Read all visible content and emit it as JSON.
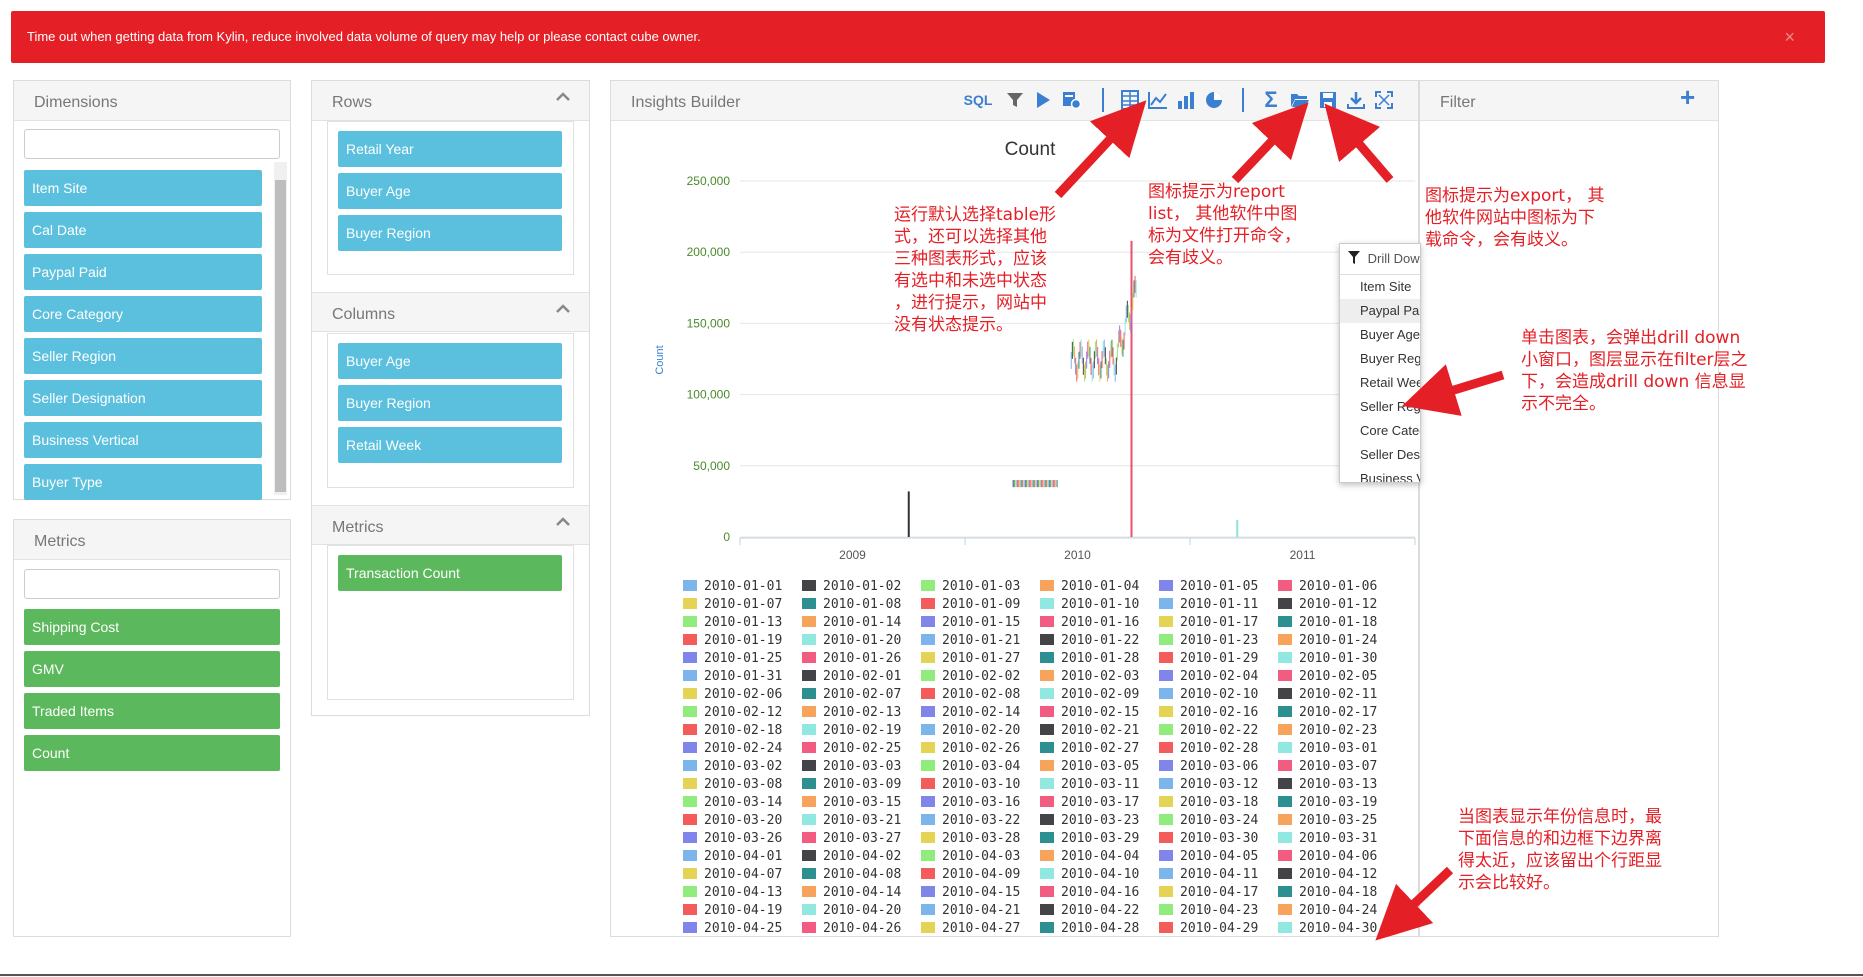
{
  "alert": {
    "message": "Time out when getting data from Kylin, reduce involved data volume of query may help or please contact cube owner.",
    "close": "×"
  },
  "dimensions": {
    "title": "Dimensions",
    "search_value": "",
    "items": [
      "Item Site",
      "Cal Date",
      "Paypal Paid",
      "Core Category",
      "Seller Region",
      "Seller Designation",
      "Business Vertical",
      "Buyer Type"
    ]
  },
  "metrics_left": {
    "title": "Metrics",
    "search_value": "",
    "items": [
      "Shipping Cost",
      "GMV",
      "Traded Items",
      "Count"
    ]
  },
  "rows": {
    "title": "Rows",
    "items": [
      "Retail Year",
      "Buyer Age",
      "Buyer Region"
    ]
  },
  "columns": {
    "title": "Columns",
    "items": [
      "Buyer Age",
      "Buyer Region",
      "Retail Week"
    ]
  },
  "metrics_mid": {
    "title": "Metrics",
    "items": [
      "Transaction Count"
    ]
  },
  "insights": {
    "title": "Insights Builder",
    "sql_label": "SQL"
  },
  "toolbar_icons": [
    "filter-icon",
    "run-icon",
    "settings-run-icon",
    "table-icon",
    "line-chart-icon",
    "bar-chart-icon",
    "pie-chart-icon",
    "sum-icon",
    "open-folder-icon",
    "save-icon",
    "export-download-icon",
    "fullscreen-icon"
  ],
  "filter": {
    "title": "Filter",
    "add": "+"
  },
  "drill": {
    "title": "Drill Down",
    "items": [
      "Item Site",
      "Paypal Paid",
      "Buyer Age",
      "Buyer Region",
      "Retail Week",
      "Seller Region",
      "Core Category",
      "Seller Designation",
      "Business Vertical"
    ]
  },
  "chart_data": {
    "type": "bar",
    "title": "Count",
    "ylabel": "Count",
    "ylim": [
      0,
      250000
    ],
    "yticks": [
      0,
      50000,
      100000,
      150000,
      200000,
      250000
    ],
    "ytick_labels": [
      "0",
      "50,000",
      "100,000",
      "150,000",
      "200,000",
      "250,000"
    ],
    "categories": [
      "2009",
      "2010",
      "2011"
    ],
    "marks": [
      {
        "x": 2009.25,
        "value": 32000,
        "color": "#333333"
      },
      {
        "x": 2010.24,
        "value": 208000,
        "color": "#e8506b"
      },
      {
        "x": 2010.71,
        "value": 12000,
        "color": "#8ee0e0"
      }
    ],
    "colors": [
      "#7cb5ec",
      "#434348",
      "#90ed7d",
      "#f7a35c",
      "#8085e9",
      "#f15c80",
      "#e4d354",
      "#2b908f",
      "#f45b5b",
      "#91e8e1"
    ]
  },
  "legend_dates": [
    "2010-01-01",
    "2010-01-02",
    "2010-01-03",
    "2010-01-04",
    "2010-01-05",
    "2010-01-06",
    "2010-01-07",
    "2010-01-08",
    "2010-01-09",
    "2010-01-10",
    "2010-01-11",
    "2010-01-12",
    "2010-01-13",
    "2010-01-14",
    "2010-01-15",
    "2010-01-16",
    "2010-01-17",
    "2010-01-18",
    "2010-01-19",
    "2010-01-20",
    "2010-01-21",
    "2010-01-22",
    "2010-01-23",
    "2010-01-24",
    "2010-01-25",
    "2010-01-26",
    "2010-01-27",
    "2010-01-28",
    "2010-01-29",
    "2010-01-30",
    "2010-01-31",
    "2010-02-01",
    "2010-02-02",
    "2010-02-03",
    "2010-02-04",
    "2010-02-05",
    "2010-02-06",
    "2010-02-07",
    "2010-02-08",
    "2010-02-09",
    "2010-02-10",
    "2010-02-11",
    "2010-02-12",
    "2010-02-13",
    "2010-02-14",
    "2010-02-15",
    "2010-02-16",
    "2010-02-17",
    "2010-02-18",
    "2010-02-19",
    "2010-02-20",
    "2010-02-21",
    "2010-02-22",
    "2010-02-23",
    "2010-02-24",
    "2010-02-25",
    "2010-02-26",
    "2010-02-27",
    "2010-02-28",
    "2010-03-01",
    "2010-03-02",
    "2010-03-03",
    "2010-03-04",
    "2010-03-05",
    "2010-03-06",
    "2010-03-07",
    "2010-03-08",
    "2010-03-09",
    "2010-03-10",
    "2010-03-11",
    "2010-03-12",
    "2010-03-13",
    "2010-03-14",
    "2010-03-15",
    "2010-03-16",
    "2010-03-17",
    "2010-03-18",
    "2010-03-19",
    "2010-03-20",
    "2010-03-21",
    "2010-03-22",
    "2010-03-23",
    "2010-03-24",
    "2010-03-25",
    "2010-03-26",
    "2010-03-27",
    "2010-03-28",
    "2010-03-29",
    "2010-03-30",
    "2010-03-31",
    "2010-04-01",
    "2010-04-02",
    "2010-04-03",
    "2010-04-04",
    "2010-04-05",
    "2010-04-06",
    "2010-04-07",
    "2010-04-08",
    "2010-04-09",
    "2010-04-10",
    "2010-04-11",
    "2010-04-12",
    "2010-04-13",
    "2010-04-14",
    "2010-04-15",
    "2010-04-16",
    "2010-04-17",
    "2010-04-18",
    "2010-04-19",
    "2010-04-20",
    "2010-04-21",
    "2010-04-22",
    "2010-04-23",
    "2010-04-24",
    "2010-04-25",
    "2010-04-26",
    "2010-04-27",
    "2010-04-28",
    "2010-04-29",
    "2010-04-30"
  ],
  "annotations": {
    "table": [
      "运行默认选择table形",
      "式，还可以选择其他",
      "三种图表形式，应该",
      "有选中和未选中状态",
      "，进行提示，网站中",
      "没有状态提示。"
    ],
    "report": [
      "图标提示为report",
      "list， 其他软件中图",
      "标为文件打开命令，",
      "会有歧义。"
    ],
    "export": [
      "图标提示为export， 其",
      "他软件网站中图标为下",
      "载命令，会有歧义。"
    ],
    "drill": [
      "单击图表，会弹出drill down",
      "小窗口，图层显示在filter层之",
      "下，会造成drill down 信息显",
      "示不完全。"
    ],
    "legend": [
      "当图表显示年份信息时，最",
      "下面信息的和边框下边界离",
      "得太近，应该留出个行距显",
      "示会比较好。"
    ]
  }
}
